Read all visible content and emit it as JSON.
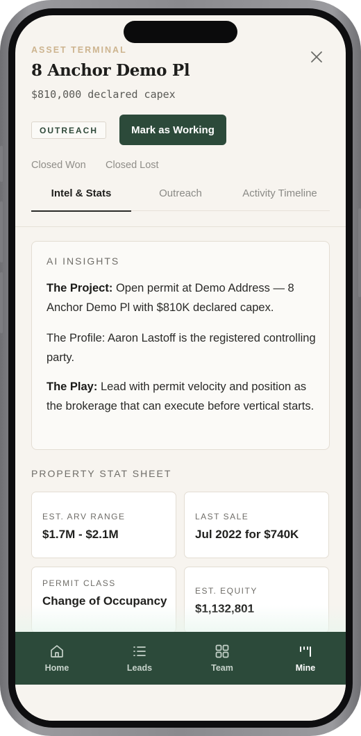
{
  "header": {
    "eyebrow": "ASSET TERMINAL",
    "title": "8 Anchor Demo Pl",
    "capex": "$810,000 declared capex",
    "close_icon": "close-icon"
  },
  "actions": {
    "badge": "OUTREACH",
    "primary_button": "Mark as Working",
    "closed_won": "Closed Won",
    "closed_lost": "Closed Lost"
  },
  "tabs": [
    {
      "label": "Intel & Stats",
      "active": true
    },
    {
      "label": "Outreach",
      "active": false
    },
    {
      "label": "Activity Timeline",
      "active": false
    }
  ],
  "insights": {
    "heading": "AI INSIGHTS",
    "project_label": "The Project:",
    "project_text": " Open permit at Demo Address — 8 Anchor Demo Pl with $810K declared capex.",
    "profile_text": "The Profile: Aaron Lastoff is the registered controlling party.",
    "play_label": "The Play:",
    "play_text": " Lead with permit velocity and position as the brokerage that can execute before vertical starts."
  },
  "stats": {
    "heading": "PROPERTY STAT SHEET",
    "items": [
      {
        "label": "EST. ARV RANGE",
        "value": "$1.7M - $2.1M"
      },
      {
        "label": "LAST SALE",
        "value": "Jul 2022 for $740K"
      },
      {
        "label": "PERMIT CLASS",
        "value": "Change of Occupancy"
      },
      {
        "label": "EST. EQUITY",
        "value": "$1,132,801"
      }
    ]
  },
  "nav": [
    {
      "label": "Home",
      "icon": "home-icon",
      "active": false
    },
    {
      "label": "Leads",
      "icon": "list-icon",
      "active": false
    },
    {
      "label": "Team",
      "icon": "grid-icon",
      "active": false
    },
    {
      "label": "Mine",
      "icon": "mine-icon",
      "active": true
    }
  ],
  "colors": {
    "accent": "#2c4a3a",
    "eyebrow": "#cdb48f",
    "background": "#f7f4ef"
  }
}
